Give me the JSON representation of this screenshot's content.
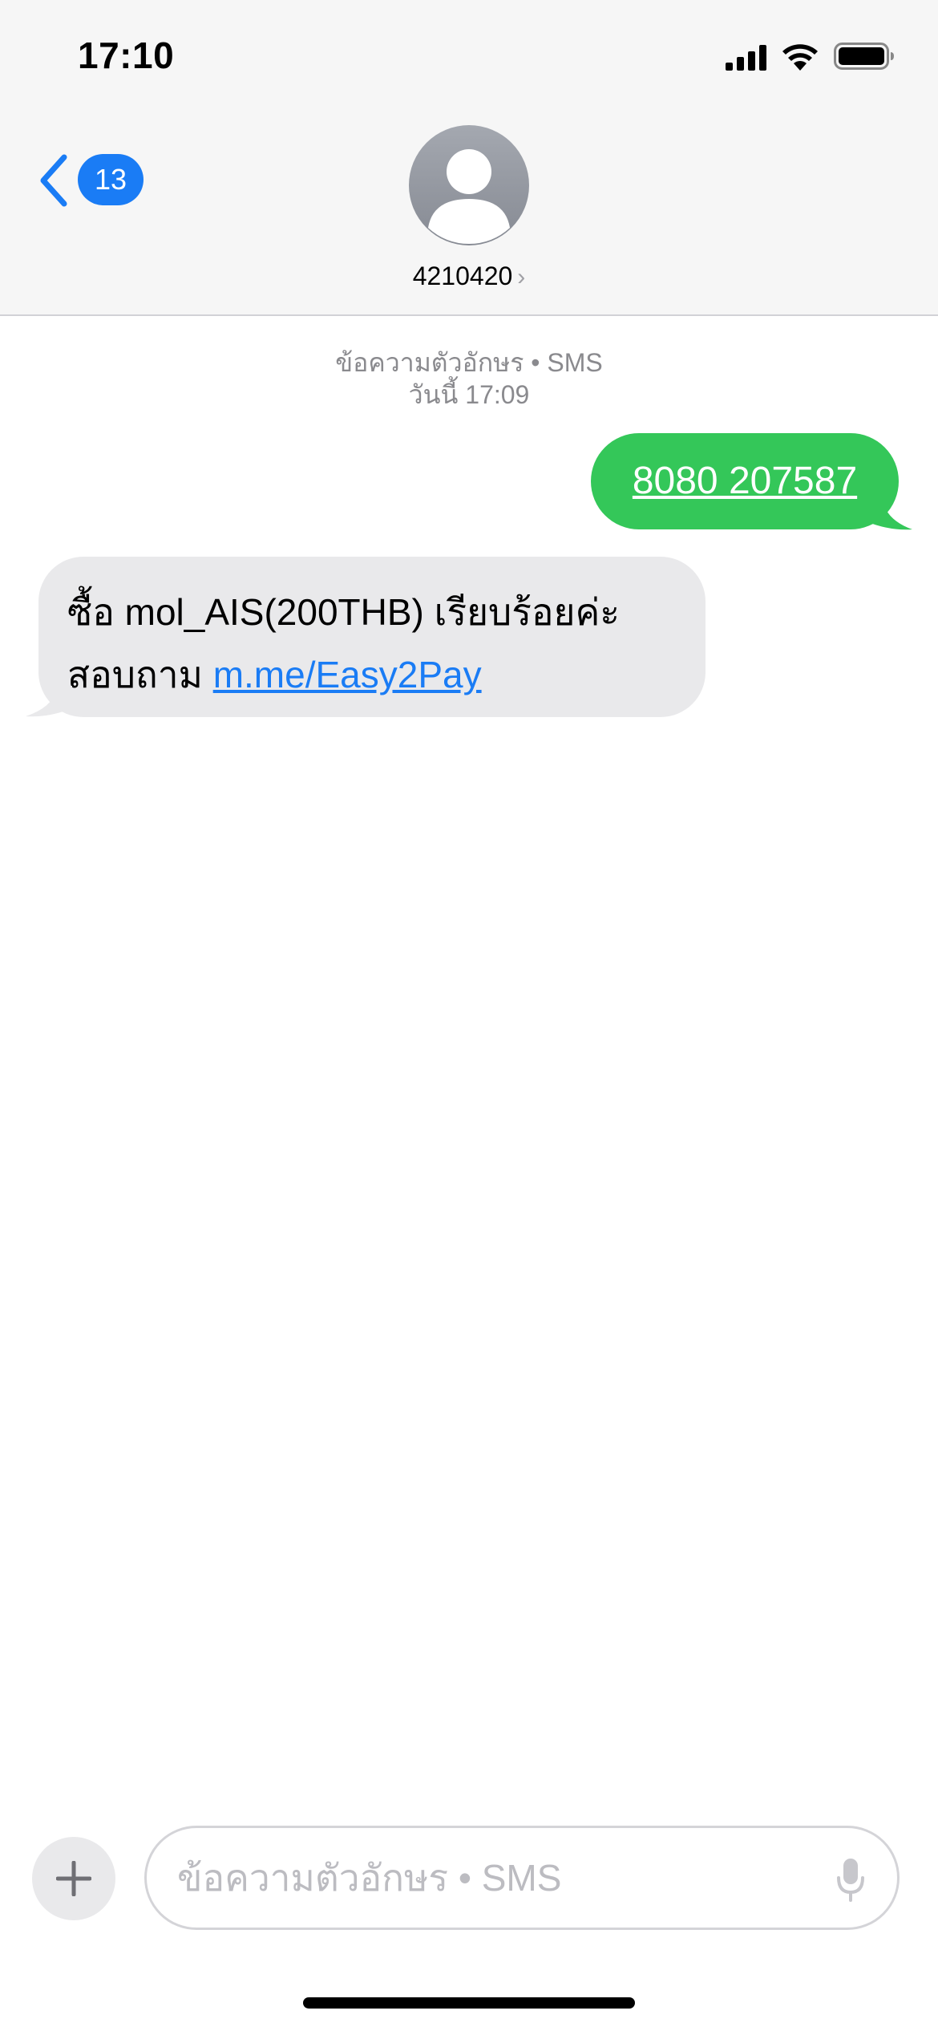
{
  "status_bar": {
    "time": "17:10",
    "signal_icon": "cellular-signal-icon",
    "wifi_icon": "wifi-icon",
    "battery_icon": "battery-icon"
  },
  "nav": {
    "back_badge_count": "13",
    "contact_name": "4210420",
    "contact_chevron": "›"
  },
  "thread": {
    "meta_line1": "ข้อความตัวอักษร • SMS",
    "meta_line2": "วันนี้ 17:09",
    "messages": [
      {
        "direction": "outgoing",
        "text": "8080 207587"
      },
      {
        "direction": "incoming",
        "line1": "ซื้อ mol_AIS(200THB) เรียบร้อยค่ะ",
        "line2_prefix": "สอบถาม ",
        "link": "m.me/Easy2Pay"
      }
    ]
  },
  "composer": {
    "placeholder": "ข้อความตัวอักษร • SMS"
  },
  "colors": {
    "accent": "#1a7cf5",
    "outgoing_bubble": "#34c759",
    "incoming_bubble": "#e9e9eb"
  }
}
